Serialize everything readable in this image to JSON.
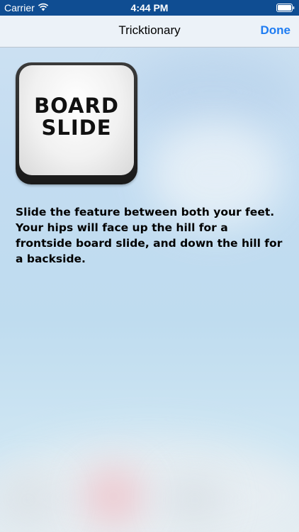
{
  "status_bar": {
    "carrier": "Carrier",
    "time": "4:44 PM",
    "wifi_icon": "wifi-icon",
    "battery_icon": "battery-icon",
    "background_color": "#0f4d92"
  },
  "nav": {
    "title": "Tricktionary",
    "done_label": "Done",
    "accent_color": "#1e7cf2"
  },
  "trick": {
    "icon_label": "BOARD\nSLIDE",
    "description": "Slide the feature between both your feet. Your hips will face up the hill for a frontside board slide, and down the hill for a backside."
  }
}
